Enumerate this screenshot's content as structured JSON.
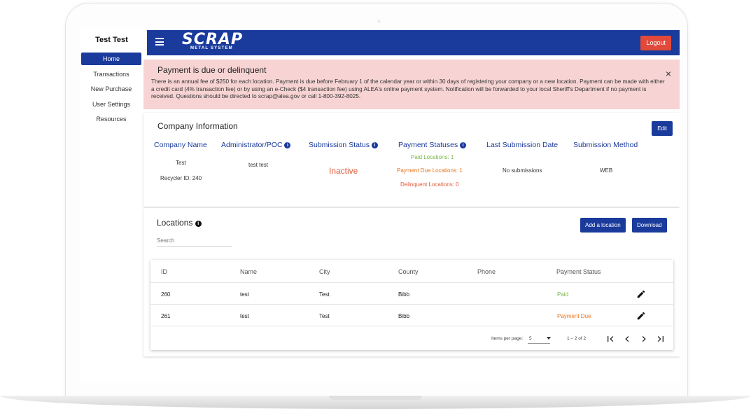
{
  "sidebar": {
    "user": "Test Test",
    "items": [
      {
        "label": "Home",
        "active": true
      },
      {
        "label": "Transactions",
        "active": false
      },
      {
        "label": "New Purchase",
        "active": false
      },
      {
        "label": "User Settings",
        "active": false
      },
      {
        "label": "Resources",
        "active": false
      }
    ]
  },
  "header": {
    "logo_main": "SCRAP",
    "logo_sub": "METAL SYSTEM",
    "logout_label": "Logout",
    "menu_icon": "hamburger-icon"
  },
  "alert": {
    "title": "Payment is due or delinquent",
    "body": "There is an annual fee of $250 for each location. Payment is due before February 1 of the calendar year or within 30 days of registering your company or a new location. Payment can be made with either a credit card (4% transaction fee) or by using an e-Check ($4 transaction fee) using ALEA's online payment system. Notification will be forwarded to your local Sheriff's Department if no payment is received. Questions should be directed to scrap@alea.gov or call 1-800-392-8025.",
    "close_glyph": "×"
  },
  "company": {
    "title": "Company Information",
    "edit_label": "Edit",
    "columns": {
      "company_name": "Company Name",
      "admin": "Administrator/POC",
      "submission_status": "Submission Status",
      "payment_statuses": "Payment Statuses",
      "last_submission": "Last Submission Date",
      "submission_method": "Submission Method"
    },
    "values": {
      "company_name": "Test",
      "recycler_id": "Recycler ID: 240",
      "admin": "test test",
      "submission_status": "Inactive",
      "paid_locations": "Paid Locations: 1",
      "payment_due_locations": "Payment Due Locations: 1",
      "delinquent_locations": "Delinquent Locations: 0",
      "last_submission": "No submissions",
      "submission_method": "WEB"
    }
  },
  "locations": {
    "title": "Locations",
    "add_label": "Add a location",
    "download_label": "Download",
    "search_placeholder": "Search",
    "headers": [
      "ID",
      "Name",
      "City",
      "County",
      "Phone",
      "Payment Status"
    ],
    "rows": [
      {
        "id": "260",
        "name": "test",
        "city": "Test",
        "county": "Bibb",
        "phone": "",
        "status": "Paid"
      },
      {
        "id": "261",
        "name": "test",
        "city": "Test",
        "county": "Bibb",
        "phone": "",
        "status": "Payment Due"
      }
    ],
    "paginator": {
      "items_per_page_label": "Items per page:",
      "items_per_page": "5",
      "range": "1 – 2 of 2"
    }
  },
  "colors": {
    "brand": "#1a3a9c",
    "logout": "#e14a3a",
    "alert_bg": "#f7d3d3",
    "paid": "#7ab648",
    "due": "#e8731c",
    "inactive": "#e05a3a"
  }
}
